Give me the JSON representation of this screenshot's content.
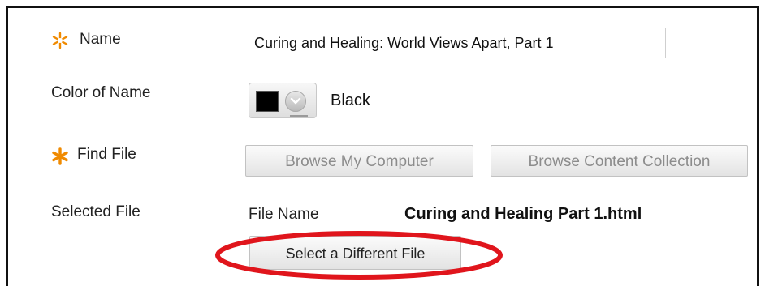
{
  "form": {
    "name_label": "Name",
    "name_value": "Curing and Healing: World Views Apart, Part 1",
    "color_label": "Color of Name",
    "color_value": "Black",
    "color_swatch": "#000000",
    "find_file_label": "Find File",
    "browse_computer_label": "Browse My Computer",
    "browse_collection_label": "Browse Content Collection",
    "selected_file_label": "Selected File",
    "file_name_label": "File Name",
    "file_name_value": "Curing and Healing Part 1.html",
    "select_different_label": "Select a Different File"
  },
  "icons": {
    "required_name": "required-asterisk-icon",
    "required_file": "required-asterisk-icon",
    "color_dropdown": "chevron-down-icon"
  },
  "colors": {
    "required_accent": "#f08a00",
    "highlight_annotation": "#e0151c"
  }
}
